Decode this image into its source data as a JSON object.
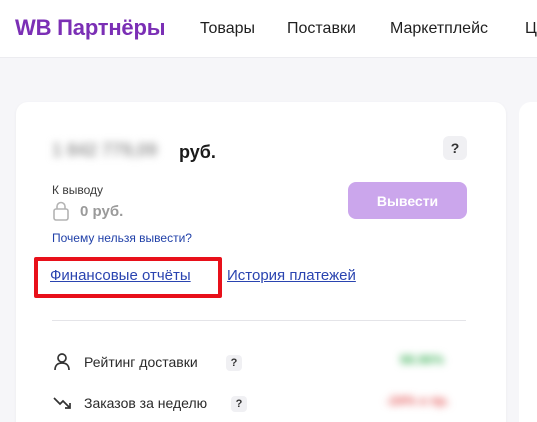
{
  "header": {
    "logo": "WB Партнёры",
    "nav": [
      "Товары",
      "Поставки",
      "Маркетплейс",
      "Ц"
    ]
  },
  "balance": {
    "amount_blurred": "1 842 779,09",
    "currency": "руб.",
    "help": "?"
  },
  "withdraw": {
    "label": "К выводу",
    "amount": "0 руб.",
    "button": "Вывести",
    "why_link": "Почему нельзя вывести?"
  },
  "links": {
    "financial_reports": "Финансовые отчёты",
    "payment_history": "История платежей"
  },
  "stats": [
    {
      "label": "Рейтинг доставки",
      "help": "?",
      "value_blurred": "98.96%"
    },
    {
      "label": "Заказов за неделю",
      "help": "?",
      "value_blurred": "-24% к пр."
    }
  ],
  "colors": {
    "brand": "#7b2fb5",
    "button": "#cba6ec",
    "link": "#2a44b0",
    "highlight": "#e8101a"
  },
  "icons": [
    "lock-icon",
    "person-icon",
    "trend-down-icon",
    "help-icon"
  ]
}
